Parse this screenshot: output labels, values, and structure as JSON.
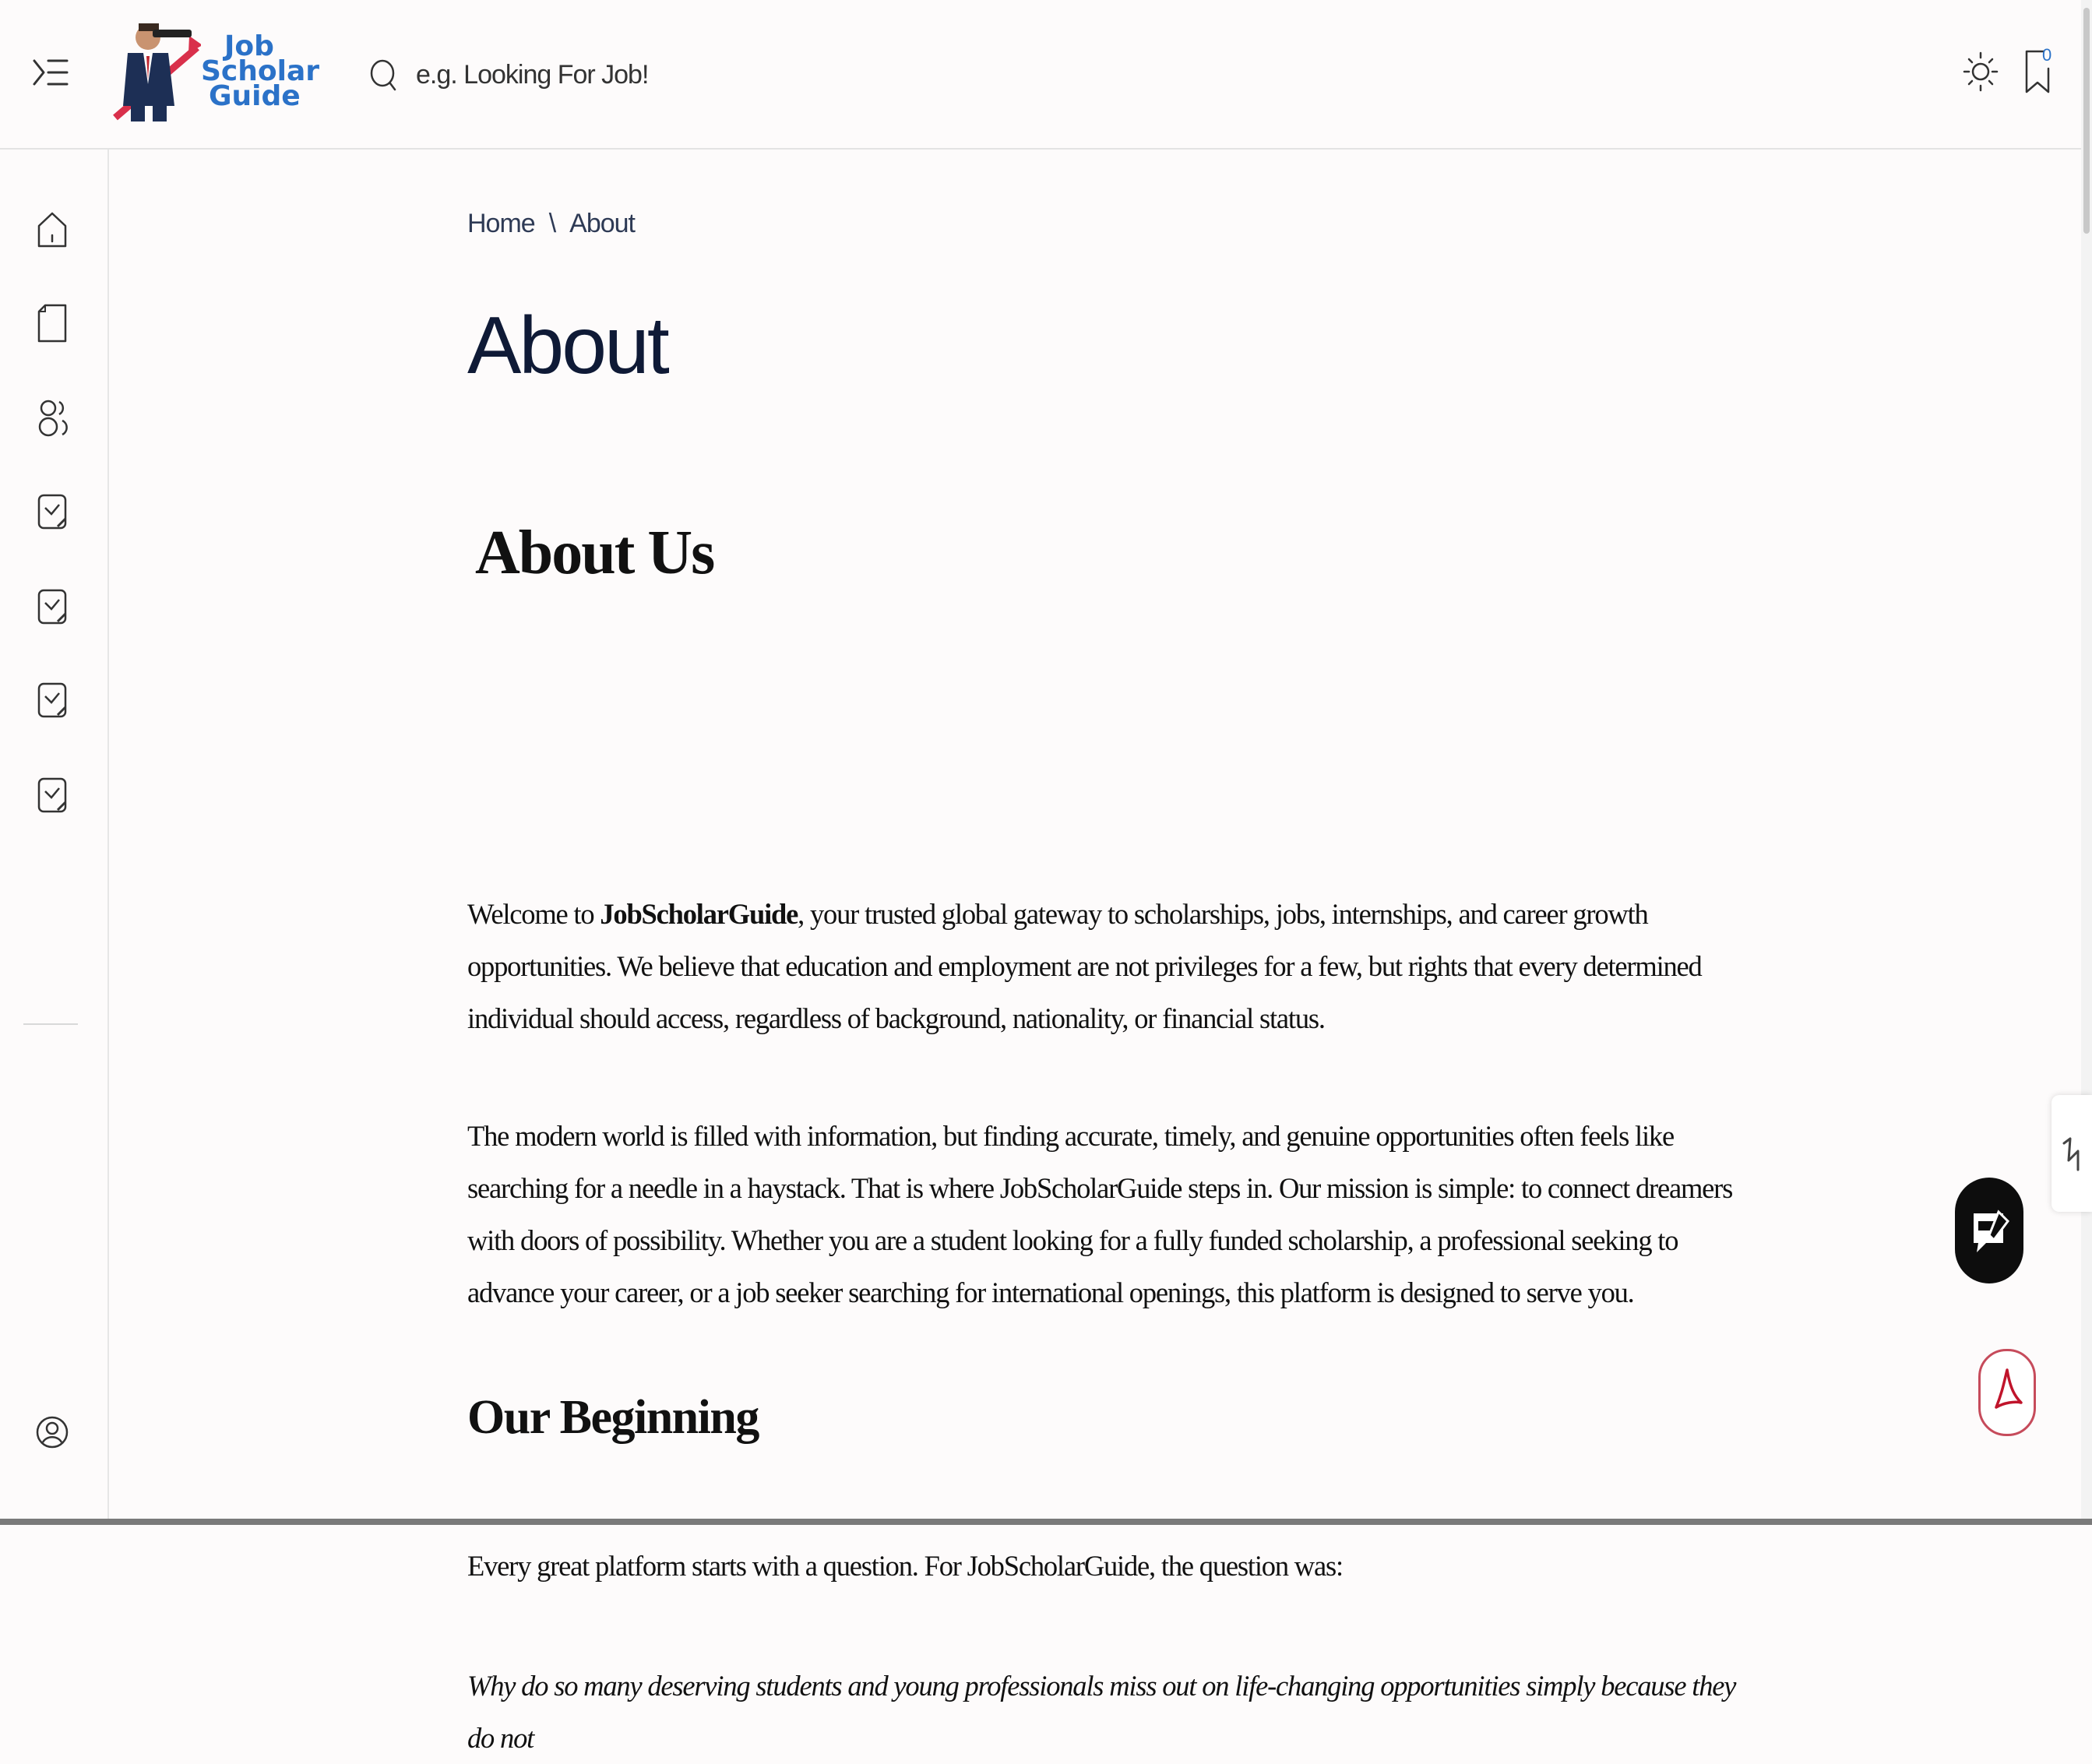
{
  "header": {
    "logo": {
      "line1": "Job",
      "line2": "Scholar",
      "line3": "Guide"
    },
    "search": {
      "placeholder": "e.g. Looking For Job!"
    },
    "bookmark_count": "0"
  },
  "breadcrumb": {
    "home": "Home",
    "separator": "\\",
    "current": "About"
  },
  "page_title": "About",
  "article": {
    "heading_about_us": "About Us",
    "p1_prefix": "Welcome to ",
    "p1_brand": "JobScholarGuide",
    "p1_rest": ", your trusted global gateway to scholarships, jobs, internships, and career growth opportunities. We believe that education and employment are not privileges for a few, but rights that every determined individual should access, regardless of background, nationality, or financial status.",
    "p2": "The modern world is filled with information, but finding accurate, timely, and genuine opportunities often feels like searching for a needle in a haystack. That is where JobScholarGuide steps in. Our mission is simple: to connect dreamers with doors of possibility. Whether you are a student looking for a fully funded scholarship, a professional seeking to advance your career, or a job seeker searching for international openings, this platform is designed to serve you.",
    "heading_beginning": "Our Beginning",
    "p3": "Every great platform starts with a question. For JobScholarGuide, the question was:",
    "p4": "Why do so many deserving students and young professionals miss out on life-changing opportunities simply because they do not"
  },
  "icons": {
    "menu": "menu-toggle-icon",
    "search": "search-icon",
    "theme": "sun-icon",
    "bookmark": "bookmark-icon",
    "sidebar": [
      "home-icon",
      "document-icon",
      "users-icon",
      "clipboard-icon",
      "clipboard-icon",
      "clipboard-icon",
      "clipboard-icon",
      "user-circle-icon"
    ],
    "floating": [
      "share-icon",
      "pdf-chat-icon",
      "pdf-icon"
    ]
  },
  "colors": {
    "brand_blue": "#2b72c8",
    "title_navy": "#0f1a36",
    "pdf_red": "#c64b5b"
  }
}
